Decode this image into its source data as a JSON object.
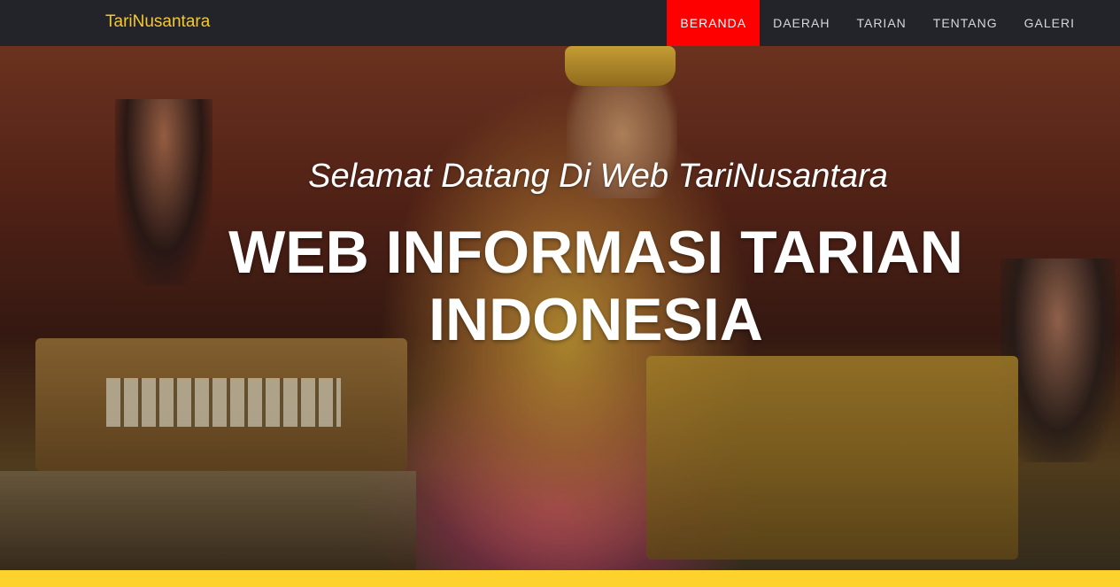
{
  "navbar": {
    "brand": "TariNusantara",
    "items": [
      {
        "label": "BERANDA",
        "active": true
      },
      {
        "label": "DAERAH",
        "active": false
      },
      {
        "label": "TARIAN",
        "active": false
      },
      {
        "label": "TENTANG",
        "active": false
      },
      {
        "label": "GALERI",
        "active": false
      }
    ]
  },
  "hero": {
    "subtitle": "Selamat Datang Di Web TariNusantara",
    "headline_line1": "WEB INFORMASI TARIAN",
    "headline_line2": "INDONESIA"
  },
  "colors": {
    "navbar_bg": "#222429",
    "brand": "#f6c830",
    "active_nav_bg": "#ff0000",
    "accent_bar": "#fdd22c"
  }
}
